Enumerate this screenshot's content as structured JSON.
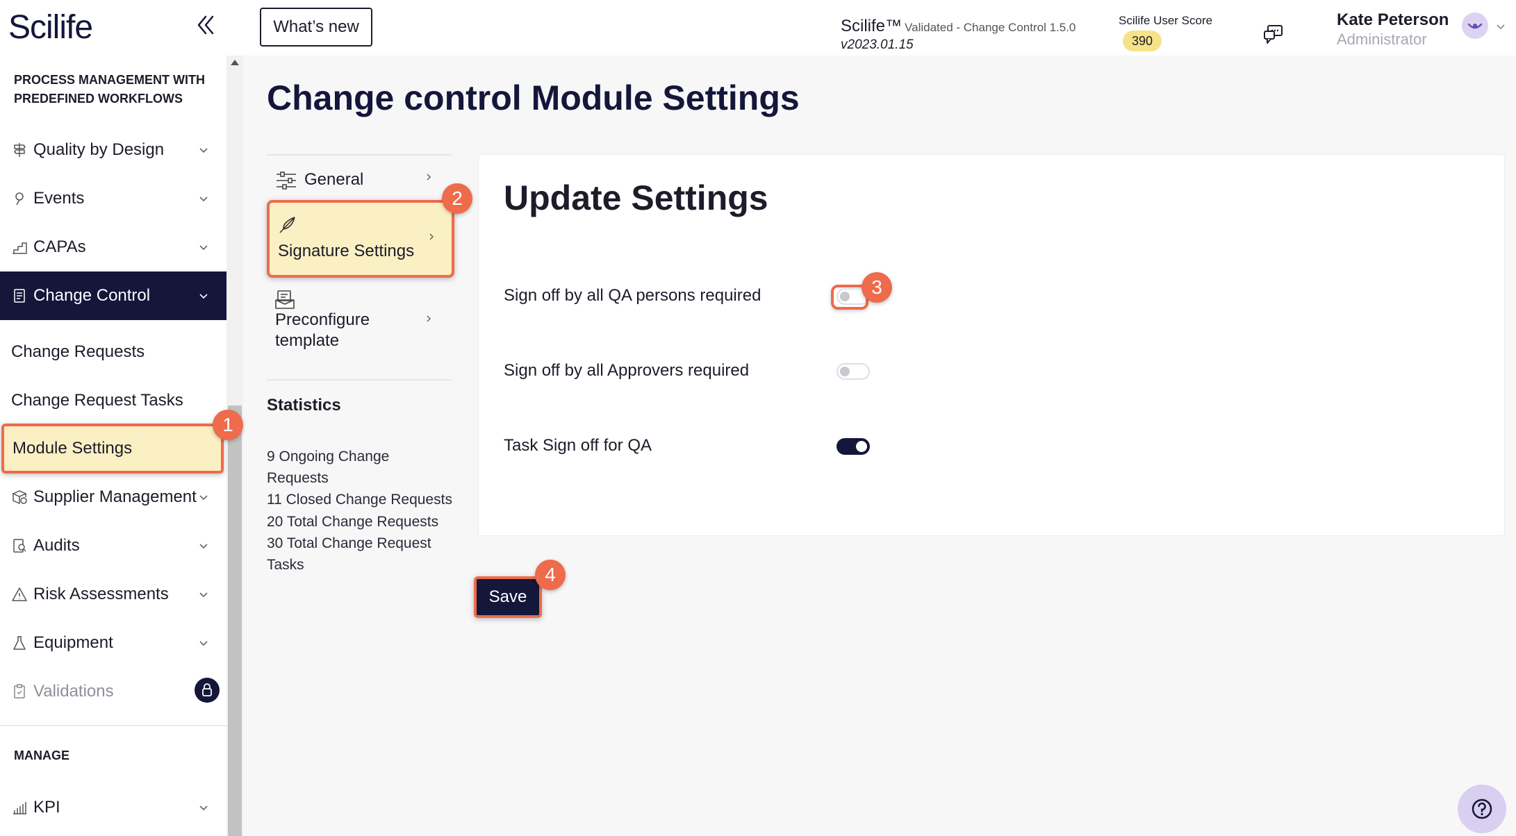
{
  "header": {
    "logo": "Scilife",
    "whats_new": "What’s new",
    "product": "Scilife™",
    "product_sub": "Validated - Change Control 1.5.0",
    "version": "v2023.01.15",
    "score_label": "Scilife User Score",
    "score": "390",
    "user_name": "Kate Peterson",
    "user_role": "Administrator"
  },
  "sidebar": {
    "section1_line1": "PROCESS MANAGEMENT WITH",
    "section1_line2": "PREDEFINED WORKFLOWS",
    "items": [
      {
        "label": "Quality by Design",
        "icon": "signpost-icon"
      },
      {
        "label": "Events",
        "icon": "pin-icon"
      },
      {
        "label": "CAPAs",
        "icon": "stairs-icon"
      },
      {
        "label": "Change Control",
        "icon": "document-icon"
      }
    ],
    "sub_items": [
      "Change Requests",
      "Change Request Tasks",
      "Module Settings"
    ],
    "items2": [
      {
        "label": "Supplier Management",
        "icon": "supplier-icon"
      },
      {
        "label": "Audits",
        "icon": "audit-icon"
      },
      {
        "label": "Risk Assessments",
        "icon": "warning-icon"
      },
      {
        "label": "Equipment",
        "icon": "flask-icon"
      },
      {
        "label": "Validations",
        "icon": "clipboard-icon"
      }
    ],
    "section2": "MANAGE",
    "kpi": "KPI"
  },
  "main": {
    "title": "Change control Module Settings",
    "subnav": {
      "general": "General",
      "signature": "Signature Settings",
      "preconfigure_line1": "Preconfigure",
      "preconfigure_line2": "template"
    },
    "stats_title": "Statistics",
    "stats": [
      "9 Ongoing Change",
      "Requests",
      "11 Closed Change Requests",
      "20 Total Change Requests",
      "30 Total Change Request",
      "Tasks"
    ],
    "card_title": "Update Settings",
    "settings": [
      {
        "label": "Sign off by all QA persons required",
        "enabled": false
      },
      {
        "label": "Sign off by all Approvers required",
        "enabled": false
      },
      {
        "label": "Task Sign off for QA",
        "enabled": true
      }
    ],
    "save": "Save"
  },
  "markers": [
    "1",
    "2",
    "3",
    "4"
  ],
  "colors": {
    "navy": "#14163a",
    "highlight": "#fbefc4",
    "marker": "#ee6b4b",
    "score": "#f7e28a"
  }
}
